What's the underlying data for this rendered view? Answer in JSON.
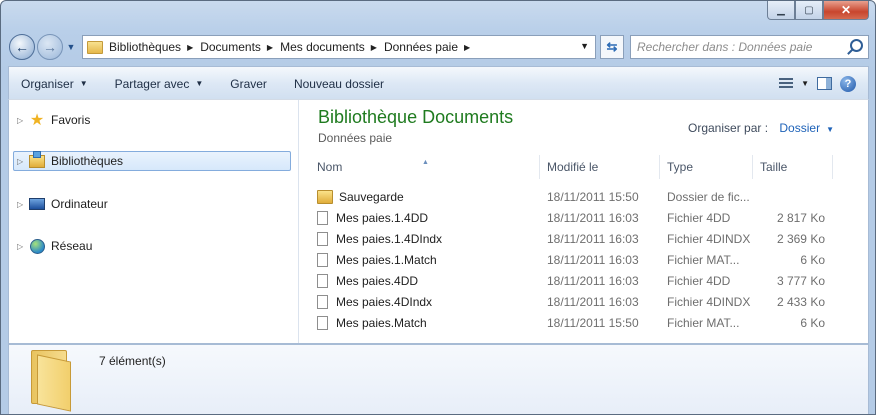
{
  "window": {
    "caption_buttons": [
      "minimize",
      "maximize",
      "close"
    ]
  },
  "navbar": {
    "breadcrumbs": [
      "Bibliothèques",
      "Documents",
      "Mes documents",
      "Données paie"
    ],
    "search_placeholder": "Rechercher dans : Données paie"
  },
  "toolbar": {
    "organize": "Organiser",
    "share": "Partager avec",
    "burn": "Graver",
    "new_folder": "Nouveau dossier"
  },
  "navpane": {
    "favorites": "Favoris",
    "libraries": "Bibliothèques",
    "computer": "Ordinateur",
    "network": "Réseau"
  },
  "library": {
    "title": "Bibliothèque Documents",
    "subtitle": "Données paie",
    "arrange_label": "Organiser par :",
    "arrange_value": "Dossier"
  },
  "columns": {
    "name": "Nom",
    "modified": "Modifié le",
    "type": "Type",
    "size": "Taille"
  },
  "files": [
    {
      "name": "Sauvegarde",
      "modified": "18/11/2011 15:50",
      "type": "Dossier de fic...",
      "size": "",
      "icon": "folder-icon"
    },
    {
      "name": "Mes paies.1.4DD",
      "modified": "18/11/2011 16:03",
      "type": "Fichier 4DD",
      "size": "2 817 Ko",
      "icon": "file-icon"
    },
    {
      "name": "Mes paies.1.4DIndx",
      "modified": "18/11/2011 16:03",
      "type": "Fichier 4DINDX",
      "size": "2 369 Ko",
      "icon": "file-icon"
    },
    {
      "name": "Mes paies.1.Match",
      "modified": "18/11/2011 16:03",
      "type": "Fichier MAT...",
      "size": "6 Ko",
      "icon": "file-icon"
    },
    {
      "name": "Mes paies.4DD",
      "modified": "18/11/2011 16:03",
      "type": "Fichier 4DD",
      "size": "3 777 Ko",
      "icon": "file-icon"
    },
    {
      "name": "Mes paies.4DIndx",
      "modified": "18/11/2011 16:03",
      "type": "Fichier 4DINDX",
      "size": "2 433 Ko",
      "icon": "file-icon"
    },
    {
      "name": "Mes paies.Match",
      "modified": "18/11/2011 15:50",
      "type": "Fichier MAT...",
      "size": "6 Ko",
      "icon": "file-icon"
    }
  ],
  "details": {
    "count": "7 élément(s)"
  },
  "colors": {
    "title_green": "#1f7b1f",
    "link_blue": "#1e62b8",
    "selection_border": "#84acdd"
  }
}
